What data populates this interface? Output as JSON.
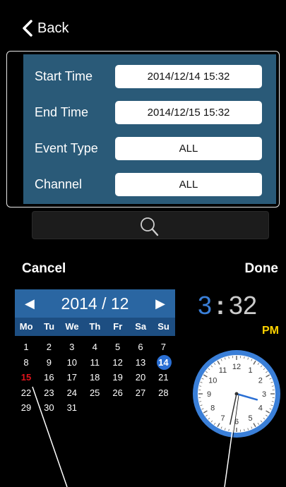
{
  "header": {
    "back_label": "Back"
  },
  "filters": {
    "start_time": {
      "label": "Start Time",
      "value": "2014/12/14  15:32"
    },
    "end_time": {
      "label": "End Time",
      "value": "2014/12/15  15:32"
    },
    "event_type": {
      "label": "Event Type",
      "value": "ALL"
    },
    "channel": {
      "label": "Channel",
      "value": "ALL"
    }
  },
  "picker": {
    "cancel_label": "Cancel",
    "done_label": "Done",
    "month_label": "2014 / 12",
    "prev_arrow": "◀",
    "next_arrow": "▶",
    "weekdays": [
      "Mo",
      "Tu",
      "We",
      "Th",
      "Fr",
      "Sa",
      "Su"
    ],
    "days": [
      [
        "1",
        "2",
        "3",
        "4",
        "5",
        "6",
        "7"
      ],
      [
        "8",
        "9",
        "10",
        "11",
        "12",
        "13",
        "14"
      ],
      [
        "15",
        "16",
        "17",
        "18",
        "19",
        "20",
        "21"
      ],
      [
        "22",
        "23",
        "24",
        "25",
        "26",
        "27",
        "28"
      ],
      [
        "29",
        "30",
        "31"
      ]
    ],
    "selected_day": "14",
    "today_day": "15",
    "hour": "3",
    "minute": "32",
    "ampm": "PM",
    "clock_numbers": [
      "12",
      "1",
      "2",
      "3",
      "4",
      "5",
      "6",
      "7",
      "8",
      "9",
      "10",
      "11"
    ]
  },
  "colors": {
    "panel": "#2a5a78",
    "calendar_header": "#2a66a2",
    "selected": "#2a6fd4",
    "today": "#e0141c",
    "ampm": "#ffd400"
  }
}
